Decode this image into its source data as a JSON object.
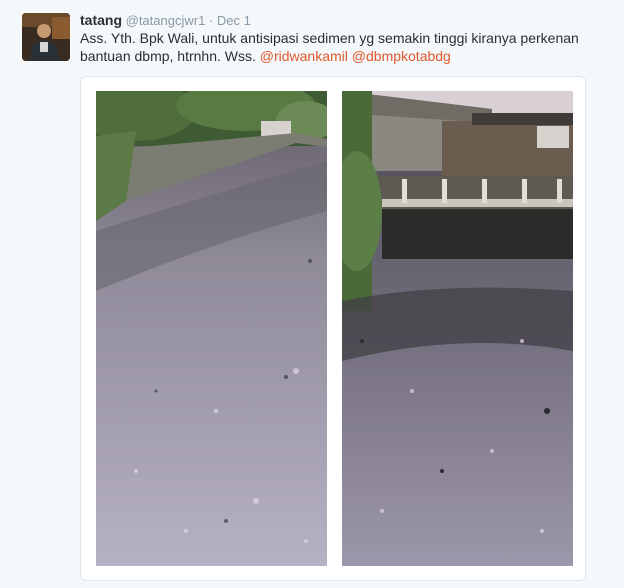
{
  "tweet": {
    "name": "tatang",
    "handle": "@tatangcjwr1",
    "separator": "·",
    "date": "Dec 1",
    "text_line1": "Ass. Yth. Bpk Wali, untuk antisipasi sedimen yg semakin tinggi kiranya perkenan",
    "text_line2": "bantuan dbmp, htrnhn. Wss.",
    "mentions": [
      "@ridwankamil",
      "@dbmpkotabdg"
    ]
  },
  "colors": {
    "mention": "#e0582d",
    "name": "#292f33",
    "muted": "#8899a6"
  },
  "icons": [
    "avatar-photo"
  ]
}
